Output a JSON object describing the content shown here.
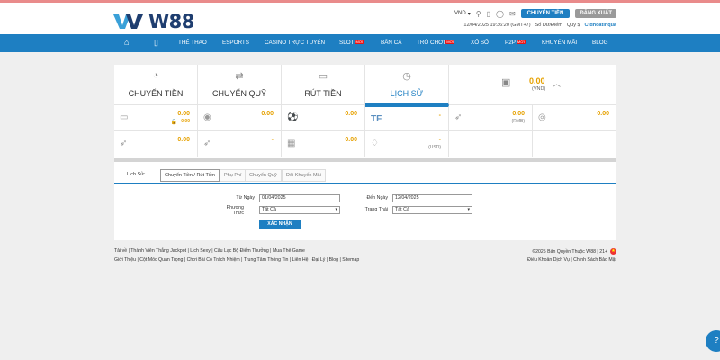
{
  "header": {
    "logo_text": "W88",
    "currency": "VND",
    "transfer_btn": "CHUYỂN TIỀN",
    "logout_btn": "ĐĂNG XUẤT",
    "datetime": "12/04/2025 19:36:20 (GMT+7)",
    "points": "Số Dư/Điểm",
    "fund": "Quỹ $",
    "username": "Ctdhoatlnqua"
  },
  "nav": {
    "items": [
      {
        "label": "THỂ THAO"
      },
      {
        "label": "ESPORTS"
      },
      {
        "label": "CASINO TRỰC TUYẾN"
      },
      {
        "label": "SLOT",
        "badge": "MỚI"
      },
      {
        "label": "BẮN CÁ"
      },
      {
        "label": "TRÒ CHƠI",
        "badge": "MỚI"
      },
      {
        "label": "XỔ SỐ"
      },
      {
        "label": "P2P",
        "badge": "MỚI"
      },
      {
        "label": "KHUYẾN MÃI"
      },
      {
        "label": "BLOG"
      }
    ]
  },
  "tabs": [
    {
      "label": "CHUYỂN TIỀN",
      "icon": "piggy-bank-icon"
    },
    {
      "label": "CHUYỂN QUỸ",
      "icon": "transfer-fund-icon"
    },
    {
      "label": "RÚT TIỀN",
      "icon": "withdraw-icon"
    },
    {
      "label": "LỊCH SỬ",
      "icon": "history-clock-icon"
    }
  ],
  "balance": {
    "amount": "0.00",
    "currency": "(VND)"
  },
  "wallets": [
    {
      "value": "0.00",
      "sub": "0.00",
      "icon": "wallet-icon",
      "locked": true
    },
    {
      "value": "0.00",
      "icon": "casino-chips-icon"
    },
    {
      "value": "0.00",
      "icon": "soccer-ball-icon"
    },
    {
      "value": "-",
      "icon": "tf-gaming-icon"
    },
    {
      "value": "0.00",
      "sub": "(RMB)",
      "icon": "fish-rmb-icon"
    },
    {
      "value": "0.00",
      "icon": "coins-icon"
    },
    {
      "value": "0.00",
      "icon": "fishing-icon"
    },
    {
      "value": "-",
      "icon": "lottery-fish-icon"
    },
    {
      "value": "0.00",
      "icon": "p2p-cards-icon"
    },
    {
      "value": "-",
      "sub": "(USD)",
      "icon": "usd-game-icon"
    }
  ],
  "history": {
    "label": "Lịch Sử:",
    "subtabs": [
      "Chuyển Tiền / Rút Tiền",
      "Phụ Phí",
      "Chuyển Quỹ",
      "Đổi Khuyến Mãi"
    ],
    "from_label": "Từ Ngày",
    "from_value": "01/04/2025",
    "to_label": "Đến Ngày",
    "to_value": "12/04/2025",
    "method_label": "Phương Thức",
    "method_value": "Tất Cả",
    "status_label": "Trạng Thái",
    "status_value": "Tất Cả",
    "submit": "XÁC NHẬN"
  },
  "footer": {
    "row1": "Tải về  |  Thành Viên Thắng Jackpot  |  Lịch Sexy  |  Câu Lạc Bộ Điểm Thưởng  |  Mua Thẻ Game",
    "row2": "Giới Thiệu  |  Cột Mốc Quan Trọng  |  Chơi Bài Có Trách Nhiệm  |  Trung Tâm Thông Tin  |  Liên Hệ  |  Đại Lý  |  Blog  |  Sitemap",
    "copyright": "©2025 Bản Quyền Thuộc W88 | 21+",
    "terms": "Điều Khoản Dịch Vụ  |  Chính Sách Bảo Mật"
  }
}
